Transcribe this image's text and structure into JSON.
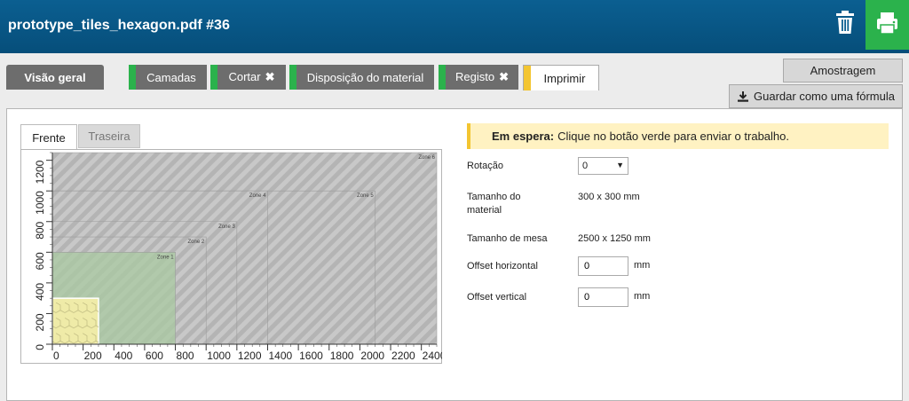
{
  "header": {
    "title": "prototype_tiles_hexagon.pdf #36",
    "trash_icon": "trash-icon",
    "print_icon": "printer-icon"
  },
  "tabs": {
    "overview": "Visão geral",
    "items": [
      {
        "label": "Camadas",
        "removable": false
      },
      {
        "label": "Cortar",
        "removable": true
      },
      {
        "label": "Disposição do material",
        "removable": false
      },
      {
        "label": "Registo",
        "removable": true
      },
      {
        "label": "Imprimir",
        "removable": false,
        "active": true
      }
    ],
    "remove_glyph": "✖"
  },
  "side_buttons": {
    "sampling": "Amostragem",
    "save_formula": "Guardar como uma fórmula",
    "download_icon": "download-icon"
  },
  "sub_tabs": {
    "front": "Frente",
    "back": "Traseira"
  },
  "status": {
    "label": "Em espera:",
    "message": "Clique no botão verde para enviar o trabalho."
  },
  "fields": {
    "rotation_label": "Rotação",
    "rotation_value": "0",
    "material_size_label": "Tamanho do material",
    "material_size_value": "300 x 300 mm",
    "table_size_label": "Tamanho de mesa",
    "table_size_value": "2500 x 1250 mm",
    "offset_h_label": "Offset horizontal",
    "offset_h_value": "0",
    "offset_v_label": "Offset vertical",
    "offset_v_value": "0",
    "unit": "mm"
  },
  "layout": {
    "x_ticks": [
      0,
      200,
      400,
      600,
      800,
      1000,
      1200,
      1400,
      1600,
      1800,
      2000,
      2200,
      2400
    ],
    "y_ticks": [
      0,
      200,
      400,
      600,
      800,
      1000,
      1200
    ],
    "table_mm": [
      2500,
      1250
    ],
    "material_mm": [
      300,
      300
    ],
    "zones": [
      {
        "name": "Zone 1",
        "w": 800,
        "h": 600
      },
      {
        "name": "Zone 2",
        "w": 1000,
        "h": 700
      },
      {
        "name": "Zone 3",
        "w": 1200,
        "h": 800
      },
      {
        "name": "Zone 4",
        "w": 1400,
        "h": 1000
      },
      {
        "name": "Zone 5",
        "w": 2100,
        "h": 1000
      },
      {
        "name": "Zone 6",
        "w": 2500,
        "h": 1250
      }
    ],
    "colors": {
      "table": "#c8c8c8",
      "stripe": "#b4b4b4",
      "zone1": "#a9c9a2",
      "material": "#efeba8"
    }
  }
}
